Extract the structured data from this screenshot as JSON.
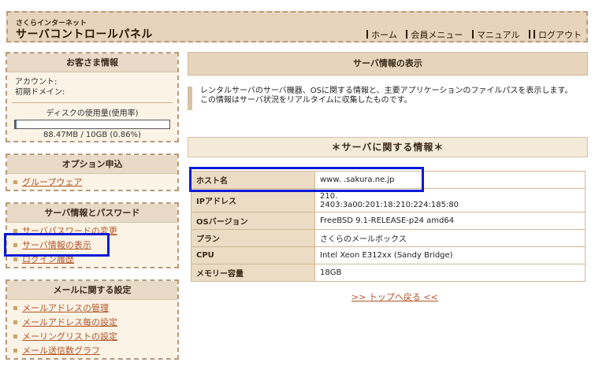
{
  "header": {
    "brand_small": "さくらインターネット",
    "brand_main": "サーバコントロールパネル",
    "nav": [
      {
        "label": "ホーム"
      },
      {
        "label": "会員メニュー"
      },
      {
        "label": "マニュアル"
      },
      {
        "label": "ログアウト"
      }
    ]
  },
  "customer": {
    "title": "お客さま情報",
    "account_label": "アカウント:",
    "domain_label": "初期ドメイン:",
    "disk_label": "ディスクの使用量(使用率)",
    "disk_value": "88.47MB / 10GB (0.86%)",
    "disk_usage_percent": 0.86,
    "disk_bar_color": "#3a6ea5"
  },
  "options": {
    "title": "オプション申込",
    "items": [
      {
        "label": "グループウェア"
      }
    ]
  },
  "server_pw": {
    "title": "サーバ情報とパスワード",
    "items": [
      {
        "label": "サーバパスワードの変更"
      },
      {
        "label": "サーバ情報の表示"
      },
      {
        "label": "ログイン履歴"
      }
    ]
  },
  "mail": {
    "title": "メールに関する設定",
    "items": [
      {
        "label": "メールアドレスの管理"
      },
      {
        "label": "メールアドレス毎の設定"
      },
      {
        "label": "メーリングリストの設定"
      },
      {
        "label": "メール送信数グラフ"
      }
    ]
  },
  "main": {
    "page_title": "サーバ情報の表示",
    "description_line1": "レンタルサーバのサーバ機器、OSに関する情報と、主要アプリケーションのファイルパスを表示します。",
    "description_line2": "この情報はサーバ状況をリアルタイムに収集したものです。",
    "section_title": "＊サーバに関する情報＊",
    "rows": [
      {
        "label": "ホスト名",
        "value": "www.      .sakura.ne.jp"
      },
      {
        "label": "IPアドレス",
        "value": "210.",
        "value2": "2403:3a00:201:18:210:224:185:80"
      },
      {
        "label": "OSバージョン",
        "value": "FreeBSD 9.1-RELEASE-p24 amd64"
      },
      {
        "label": "プラン",
        "value": "さくらのメールボックス"
      },
      {
        "label": "CPU",
        "value": "Intel Xeon E312xx (Sandy Bridge)"
      },
      {
        "label": "メモリー容量",
        "value": "18GB"
      }
    ],
    "back_link": ">> トップへ戻る <<"
  },
  "colors": {
    "highlight": "#0a1ad8",
    "accent_bg": "#e6d4bc",
    "link": "#b0552a"
  }
}
